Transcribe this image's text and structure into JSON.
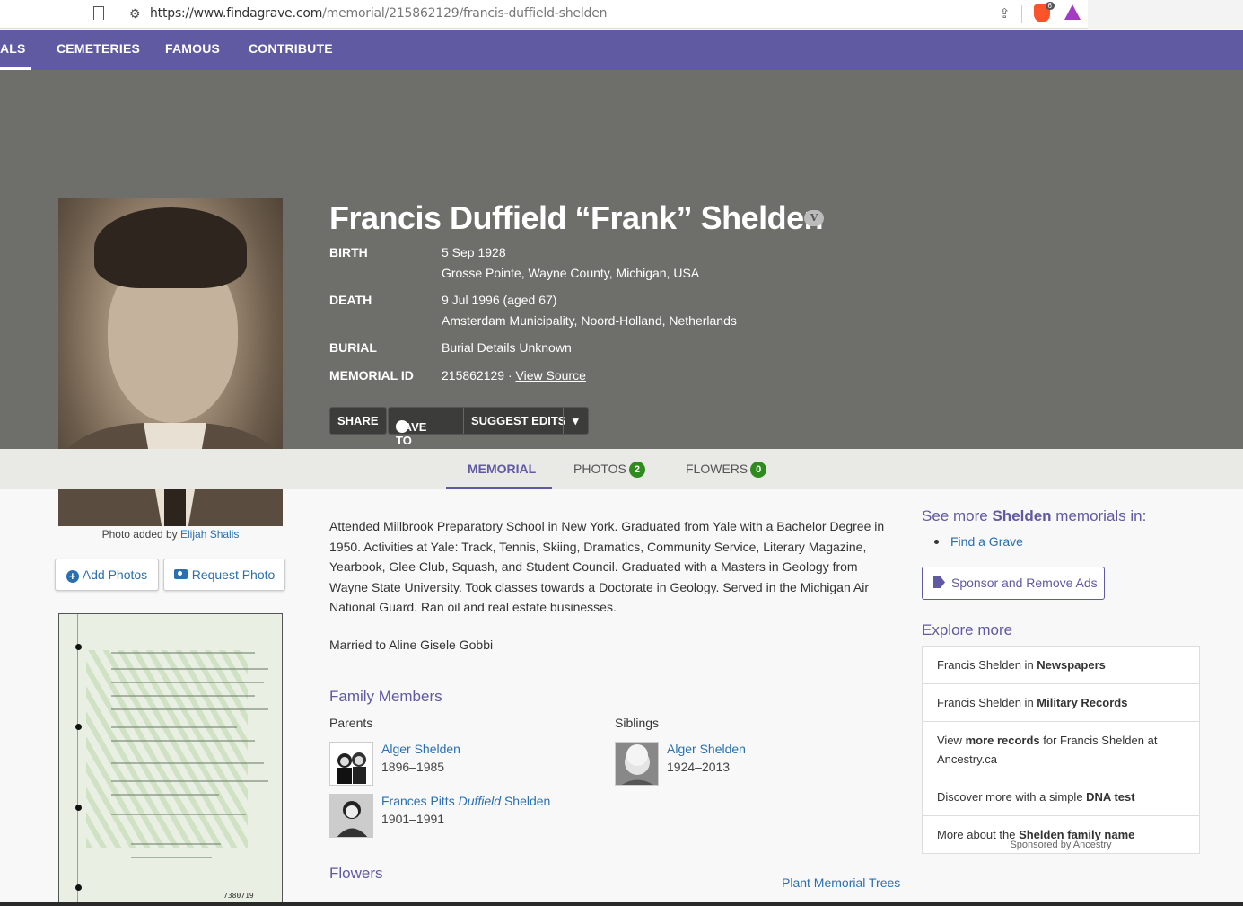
{
  "browser": {
    "url_main": "https://www.findagrave.com",
    "url_path": "/memorial/215862129/francis-duffield-shelden",
    "brave_count": "6"
  },
  "nav": {
    "items": [
      "ALS",
      "CEMETERIES",
      "FAMOUS",
      "CONTRIBUTE"
    ]
  },
  "memorial": {
    "name": "Francis Duffield “Frank” Shelden",
    "verified_badge": "V",
    "birth_label": "BIRTH",
    "birth_date": "5 Sep 1928",
    "birth_place": "Grosse Pointe, Wayne County, Michigan, USA",
    "death_label": "DEATH",
    "death_date": "9 Jul 1996 (aged 67)",
    "death_place": "Amsterdam Municipality, Noord-Holland, Netherlands",
    "burial_label": "BURIAL",
    "burial_value": "Burial Details Unknown",
    "id_label": "MEMORIAL ID",
    "id_value": "215862129 · ",
    "view_source": "View Source"
  },
  "actions": {
    "share": "SHARE",
    "save_to": "SAVE TO",
    "suggest_edits": "SUGGEST EDITS",
    "caret": "▾"
  },
  "photo": {
    "credit_prefix": "Photo added by ",
    "credit_name": "Elijah Shalis",
    "add_photos": "Add Photos",
    "request_photo": "Request Photo"
  },
  "tabs": {
    "memorial": "MEMORIAL",
    "photos": "PHOTOS",
    "photos_count": "2",
    "flowers": "FLOWERS",
    "flowers_count": "0"
  },
  "bio": {
    "text": "Attended Millbrook Preparatory School in New York. Graduated from Yale with a Bachelor Degree in 1950. Activities at Yale: Track, Tennis, Skiing, Dramatics, Community Service, Literary Magazine, Yearbook, Glee Club, Squash, and Student Council. Graduated with a Masters in Geology from Wayne State University. Took classes towards a Doctorate in Geology. Served in the Michigan Air National Guard. Ran oil and real estate businesses.",
    "married": "Married to Aline Gisele Gobbi"
  },
  "family": {
    "title": "Family Members",
    "parents_label": "Parents",
    "siblings_label": "Siblings",
    "parents": [
      {
        "name": "Alger Shelden",
        "dates": "1896–1985"
      },
      {
        "name_first": "Frances Pitts ",
        "name_italic": "Duffield",
        "name_last": " Shelden",
        "dates": "1901–1991"
      }
    ],
    "siblings": [
      {
        "name": "Alger Shelden",
        "dates": "1924–2013"
      }
    ]
  },
  "flowers": {
    "title": "Flowers",
    "plant_link": "Plant Memorial Trees"
  },
  "sidebar": {
    "see_more_prefix": "See more ",
    "see_more_bold": "Shelden",
    "see_more_suffix": " memorials in:",
    "find_a_grave": "Find a Grave",
    "sponsor_button": "Sponsor and Remove Ads",
    "explore_title": "Explore more",
    "explore_items": [
      {
        "pre": "Francis Shelden in ",
        "bold": "Newspapers",
        "post": ""
      },
      {
        "pre": "Francis Shelden in ",
        "bold": "Military Records",
        "post": ""
      },
      {
        "pre": "View ",
        "bold": "more records",
        "post": " for Francis Shelden at Ancestry.ca"
      },
      {
        "pre": "Discover more with a simple ",
        "bold": "DNA test",
        "post": ""
      },
      {
        "pre": "More about the ",
        "bold": "Shelden family name",
        "post": ""
      }
    ],
    "sponsored_by": "Sponsored by Ancestry"
  },
  "document": {
    "number": "7380719"
  },
  "colors": {
    "nav": "#5f5aa2",
    "hero": "#6e6e6a",
    "link": "#2a6fb0",
    "badge_green": "#2e8b1e"
  }
}
